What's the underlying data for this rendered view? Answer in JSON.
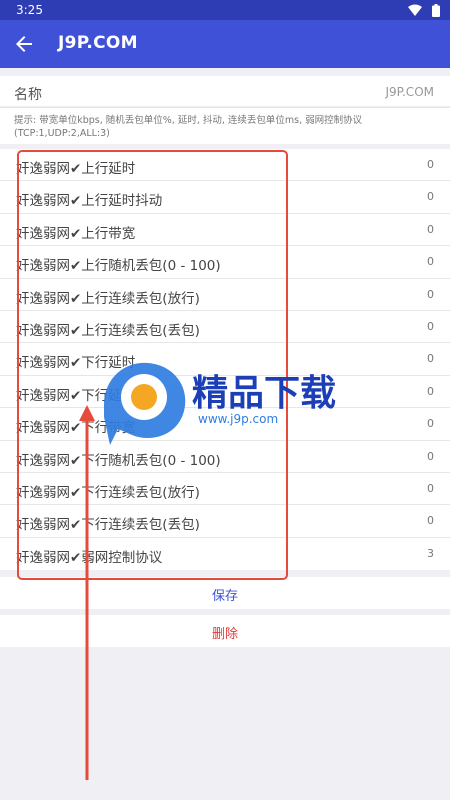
{
  "status_bar": {
    "time": "3:25",
    "wifi_icon": "wifi-icon",
    "battery_icon": "battery-icon"
  },
  "app_bar": {
    "title": "J9P.COM",
    "back_icon": "arrow-back-icon"
  },
  "name_field": {
    "label": "名称",
    "value": "J9P.COM"
  },
  "tip": "提示: 带宽单位kbps, 随机丢包单位%, 延时, 抖动, 连续丢包单位ms, 弱网控制协议(TCP:1,UDP:2,ALL:3)",
  "rows": [
    {
      "label": "奸逸弱网✔上行延时",
      "value": "0"
    },
    {
      "label": "奸逸弱网✔上行延时抖动",
      "value": "0"
    },
    {
      "label": "奸逸弱网✔上行带宽",
      "value": "0"
    },
    {
      "label": "奸逸弱网✔上行随机丢包(0 - 100)",
      "value": "0"
    },
    {
      "label": "奸逸弱网✔上行连续丢包(放行)",
      "value": "0"
    },
    {
      "label": "奸逸弱网✔上行连续丢包(丢包)",
      "value": "0"
    },
    {
      "label": "奸逸弱网✔下行延时",
      "value": "0"
    },
    {
      "label": "奸逸弱网✔下行延时抖动",
      "value": "0"
    },
    {
      "label": "奸逸弱网✔下行带宽",
      "value": "0"
    },
    {
      "label": "奸逸弱网✔下行随机丢包(0 - 100)",
      "value": "0"
    },
    {
      "label": "奸逸弱网✔下行连续丢包(放行)",
      "value": "0"
    },
    {
      "label": "奸逸弱网✔下行连续丢包(丢包)",
      "value": "0"
    },
    {
      "label": "奸逸弱网✔弱网控制协议",
      "value": "3"
    }
  ],
  "buttons": {
    "save": "保存",
    "delete": "删除"
  },
  "watermark": {
    "brand": "精品下载",
    "url": "www.j9p.com"
  },
  "colors": {
    "app_bar": "#3f51d6",
    "status_bar": "#2e3db3",
    "annotation": "#e64a3b",
    "delete": "#e53935"
  }
}
